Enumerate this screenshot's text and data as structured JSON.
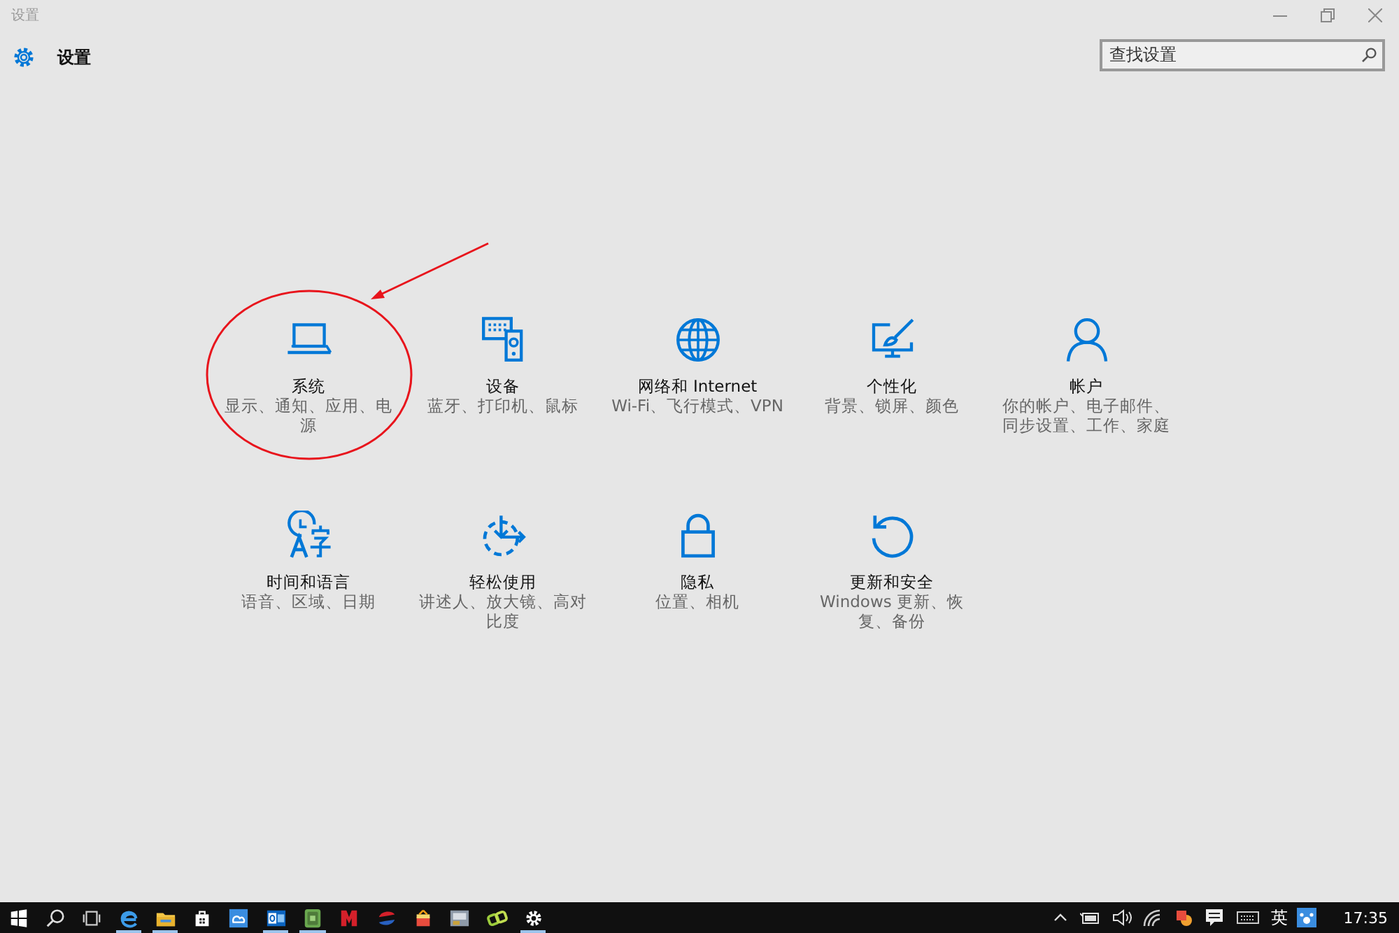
{
  "window": {
    "title": "设置"
  },
  "header": {
    "title": "设置"
  },
  "search": {
    "placeholder": "查找设置"
  },
  "tiles": [
    {
      "kind": "laptop",
      "title": "系统",
      "subtitle": "显示、通知、应用、电源",
      "highlighted": true
    },
    {
      "kind": "devices",
      "title": "设备",
      "subtitle": "蓝牙、打印机、鼠标",
      "highlighted": false
    },
    {
      "kind": "globe",
      "title": "网络和 Internet",
      "subtitle": "Wi-Fi、飞行模式、VPN",
      "highlighted": false
    },
    {
      "kind": "personalize",
      "title": "个性化",
      "subtitle": "背景、锁屏、颜色",
      "highlighted": false
    },
    {
      "kind": "person",
      "title": "帐户",
      "subtitle": "你的帐户、电子邮件、同步设置、工作、家庭",
      "highlighted": false
    },
    {
      "kind": "time",
      "title": "时间和语言",
      "subtitle": "语音、区域、日期",
      "highlighted": false
    },
    {
      "kind": "ease",
      "title": "轻松使用",
      "subtitle": "讲述人、放大镜、高对比度",
      "highlighted": false
    },
    {
      "kind": "lock",
      "title": "隐私",
      "subtitle": "位置、相机",
      "highlighted": false
    },
    {
      "kind": "update",
      "title": "更新和安全",
      "subtitle": "Windows 更新、恢复、备份",
      "highlighted": false
    }
  ],
  "taskbar": {
    "apps": [
      {
        "kind": "start",
        "running": false
      },
      {
        "kind": "search",
        "running": false
      },
      {
        "kind": "taskview",
        "running": false
      },
      {
        "kind": "edge",
        "running": true
      },
      {
        "kind": "folder",
        "running": true
      },
      {
        "kind": "store",
        "running": false
      },
      {
        "kind": "cloud",
        "running": false
      },
      {
        "kind": "mail",
        "running": true
      },
      {
        "kind": "notebook",
        "running": true
      },
      {
        "kind": "letter-m",
        "running": false
      },
      {
        "kind": "swirl",
        "running": false
      },
      {
        "kind": "gift",
        "running": false
      },
      {
        "kind": "tool",
        "running": false
      },
      {
        "kind": "chain",
        "running": false
      },
      {
        "kind": "gear",
        "running": true
      }
    ],
    "tray": {
      "ime": "英",
      "time": "17:35"
    }
  }
}
